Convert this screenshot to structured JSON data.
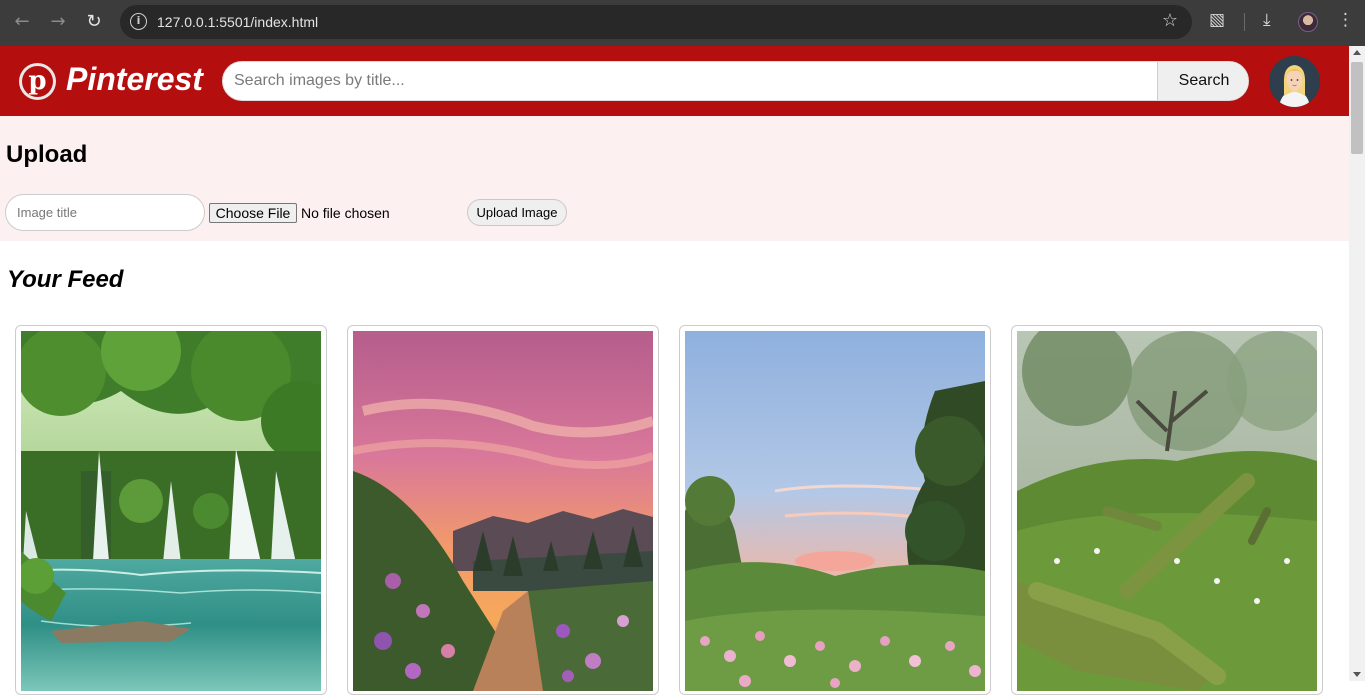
{
  "browser": {
    "url": "127.0.0.1:5501/index.html",
    "icons": [
      "back-icon",
      "forward-icon",
      "reload-icon",
      "site-info-icon",
      "bookmark-star-icon",
      "extensions-icon",
      "download-icon",
      "profile-icon",
      "kebab-menu-icon"
    ]
  },
  "header": {
    "brand": "Pinterest",
    "logo_letter": "p",
    "search_placeholder": "Search images by title...",
    "search_button": "Search",
    "colors": {
      "header_bg": "#b50e0e",
      "upload_bg": "#fcf0f1"
    }
  },
  "upload": {
    "heading": "Upload",
    "title_placeholder": "Image title",
    "choose_file_label": "Choose File",
    "no_file_text": "No file chosen",
    "upload_button": "Upload Image"
  },
  "feed": {
    "heading": "Your Feed",
    "cards": [
      {
        "scene": "waterfall-lagoon"
      },
      {
        "scene": "sunset-mountain-trail"
      },
      {
        "scene": "sunrise-meadow"
      },
      {
        "scene": "mossy-forest"
      }
    ]
  }
}
